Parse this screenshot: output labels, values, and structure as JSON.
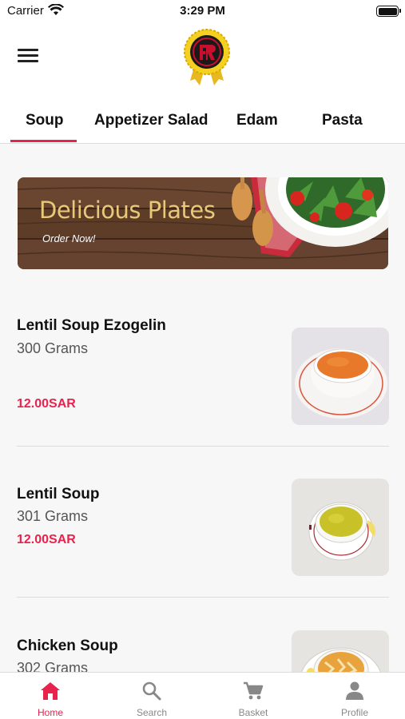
{
  "status_bar": {
    "carrier": "Carrier",
    "time": "3:29 PM"
  },
  "header": {
    "logo_icon": "restaurant-medal-logo",
    "menu_icon": "hamburger-menu-icon"
  },
  "tabs": [
    {
      "label": "Soup",
      "active": true
    },
    {
      "label": "Appetizer Salad",
      "active": false
    },
    {
      "label": "Edam",
      "active": false
    },
    {
      "label": "Pasta",
      "active": false
    }
  ],
  "banner": {
    "title": "Delicious Plates",
    "subtitle": "Order Now!"
  },
  "products": [
    {
      "name": "Lentil Soup Ezogelin",
      "weight": "300 Grams",
      "price": "12.00SAR"
    },
    {
      "name": "Lentil Soup",
      "weight": "301 Grams",
      "price": "12.00SAR"
    },
    {
      "name": "Chicken Soup",
      "weight": "302 Grams",
      "price": ""
    }
  ],
  "bottom_nav": [
    {
      "label": "Home",
      "icon": "home-icon",
      "active": true
    },
    {
      "label": "Search",
      "icon": "search-icon",
      "active": false
    },
    {
      "label": "Basket",
      "icon": "cart-icon",
      "active": false
    },
    {
      "label": "Profile",
      "icon": "person-icon",
      "active": false
    }
  ],
  "colors": {
    "accent": "#e8234d",
    "background": "#f7f7f7",
    "banner_gold": "#e8c978"
  }
}
